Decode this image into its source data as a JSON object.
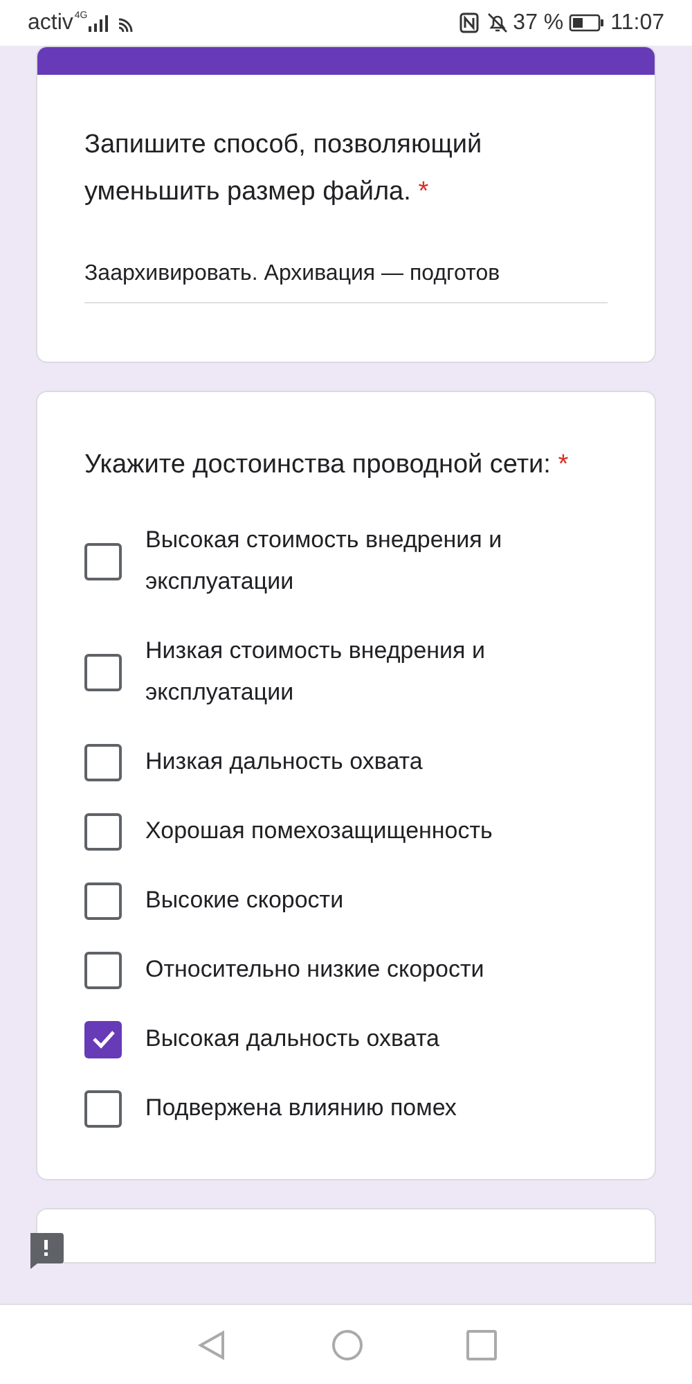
{
  "status_bar": {
    "carrier": "activ",
    "network": "4G",
    "battery": "37 %",
    "time": "11:07"
  },
  "questions": [
    {
      "kind": "text",
      "title": "Запишите способ, позволяющий уменьшить размер файла.",
      "required_mark": "*",
      "value": "Заархивировать. Архивация — подготов"
    },
    {
      "kind": "checkboxes",
      "title": "Укажите достоинства проводной сети:",
      "required_mark": "*",
      "options": [
        {
          "label": "Высокая стоимость внедрения и эксплуатации",
          "checked": false
        },
        {
          "label": "Низкая стоимость внедрения и эксплуатации",
          "checked": false
        },
        {
          "label": "Низкая дальность охвата",
          "checked": false
        },
        {
          "label": "Хорошая помехозащищенность",
          "checked": false
        },
        {
          "label": "Высокие скорости",
          "checked": false
        },
        {
          "label": "Относительно низкие скорости",
          "checked": false
        },
        {
          "label": "Высокая дальность охвата",
          "checked": true
        },
        {
          "label": "Подвержена влиянию помех",
          "checked": false
        }
      ]
    }
  ]
}
